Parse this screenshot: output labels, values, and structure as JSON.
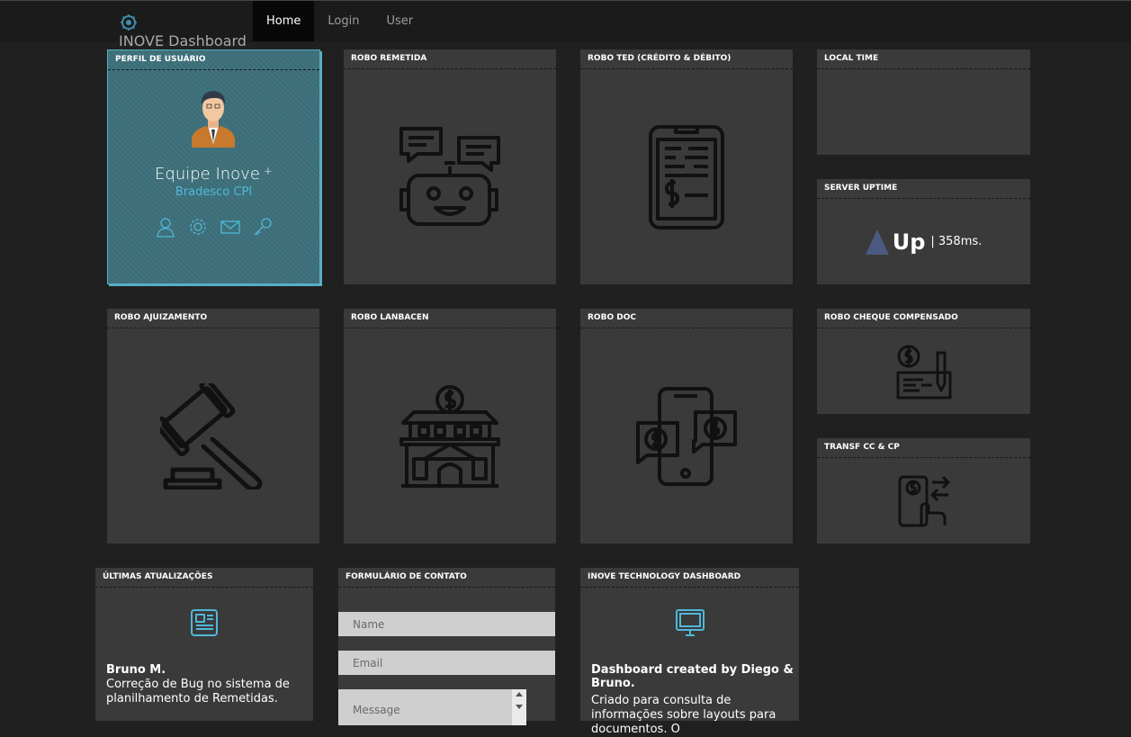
{
  "brand": {
    "title": "INOVE Dashboard",
    "logo_icon": "gear-globe-icon"
  },
  "nav": {
    "items": [
      {
        "label": "Home",
        "active": true
      },
      {
        "label": "Login",
        "active": false
      },
      {
        "label": "User",
        "active": false
      }
    ]
  },
  "tiles": {
    "profile": {
      "title": "PERFIL DE USUÁRIO",
      "name": "Equipe Inove",
      "plus": "+",
      "subtitle": "Bradesco CPI",
      "actions": [
        "user-icon",
        "gear-icon",
        "mail-icon",
        "key-icon"
      ]
    },
    "remetida": {
      "title": "ROBO REMETIDA",
      "icon": "robot-chat-icon"
    },
    "ted": {
      "title": "ROBO TED (CRÉDITO & DÉBITO)",
      "icon": "tablet-invoice-icon"
    },
    "local_time": {
      "title": "LOCAL TIME"
    },
    "server_uptime": {
      "title": "SERVER UPTIME",
      "status": "Up",
      "latency": "| 358ms."
    },
    "ajuizamento": {
      "title": "ROBO AJUIZAMENTO",
      "icon": "gavel-icon"
    },
    "lanbacen": {
      "title": "ROBO LANBACEN",
      "icon": "bank-icon"
    },
    "doc": {
      "title": "ROBO DOC",
      "icon": "phone-money-exchange-icon"
    },
    "cheque": {
      "title": "ROBO CHEQUE COMPENSADO",
      "icon": "cheque-icon"
    },
    "transf": {
      "title": "TRANSF CC & CP",
      "icon": "phone-transfer-icon"
    },
    "updates": {
      "title": "ÚLTIMAS ATUALIZAÇÕES",
      "icon": "newspaper-icon",
      "author": "Bruno M.",
      "text": "Correção de Bug no sistema de planilhamento de Remetidas."
    },
    "contact": {
      "title": "FORMULÁRIO DE CONTATO",
      "name_placeholder": "Name",
      "email_placeholder": "Email",
      "message_placeholder": "Message"
    },
    "dashboard": {
      "title": "INOVE TECHNOLOGY DASHBOARD",
      "icon": "monitor-icon",
      "credit": "Dashboard created by Diego & Bruno.",
      "description": "Criado para consulta de informações sobre layouts para documentos. O"
    }
  },
  "colors": {
    "accent": "#4fb8d8",
    "profile_bg": "#3b6d78",
    "tile_bg": "#3a3a3a",
    "page_bg": "#202020",
    "icon_stroke": "#111111"
  }
}
